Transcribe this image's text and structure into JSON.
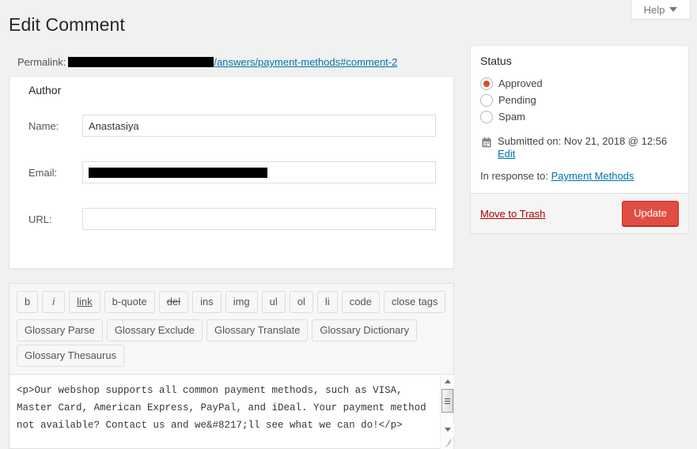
{
  "help_tab": {
    "label": "Help",
    "icon": "chevron-down-icon"
  },
  "page_title": "Edit Comment",
  "permalink": {
    "label": "Permalink:",
    "redacted_prefix": "",
    "visible_url": "/answers/payment-methods#comment-2"
  },
  "author": {
    "heading": "Author",
    "fields": [
      {
        "label": "Name:",
        "value": "Anastasiya",
        "redacted": false
      },
      {
        "label": "Email:",
        "value": "",
        "redacted": true
      },
      {
        "label": "URL:",
        "value": "",
        "redacted": false
      }
    ]
  },
  "editor": {
    "quicktag_buttons": [
      {
        "label": "b",
        "style": "bold"
      },
      {
        "label": "i",
        "style": "italic"
      },
      {
        "label": "link",
        "style": "link"
      },
      {
        "label": "b-quote",
        "style": "plain"
      },
      {
        "label": "del",
        "style": "del"
      },
      {
        "label": "ins",
        "style": "plain"
      },
      {
        "label": "img",
        "style": "plain"
      },
      {
        "label": "ul",
        "style": "plain"
      },
      {
        "label": "ol",
        "style": "plain"
      },
      {
        "label": "li",
        "style": "plain"
      },
      {
        "label": "code",
        "style": "plain"
      },
      {
        "label": "close tags",
        "style": "plain"
      }
    ],
    "glossary_buttons": [
      {
        "label": "Glossary Parse"
      },
      {
        "label": "Glossary Exclude"
      },
      {
        "label": "Glossary Translate"
      },
      {
        "label": "Glossary Dictionary"
      },
      {
        "label": "Glossary Thesaurus"
      }
    ],
    "content": "<p>Our webshop supports all common payment methods, such as VISA, Master Card, American Express, PayPal, and iDeal. Your payment method not available? Contact us and we&#8217;ll see what we can do!</p>"
  },
  "status": {
    "heading": "Status",
    "options": [
      {
        "label": "Approved",
        "checked": true
      },
      {
        "label": "Pending",
        "checked": false
      },
      {
        "label": "Spam",
        "checked": false
      }
    ],
    "submitted_prefix": "Submitted on:",
    "submitted_date": "Nov 21, 2018 @ 12:56",
    "edit_label": "Edit",
    "in_response_prefix": "In response to:",
    "in_response_link": "Payment Methods",
    "trash_label": "Move to Trash",
    "update_label": "Update",
    "calendar_icon": "calendar-icon"
  },
  "colors": {
    "accent_red": "#d54e21",
    "button_red": "#e14d43",
    "link_blue": "#0073aa",
    "trash_red": "#a00",
    "page_bg": "#f1f1f1",
    "panel_bg": "#ffffff",
    "heading": "#23282d"
  }
}
